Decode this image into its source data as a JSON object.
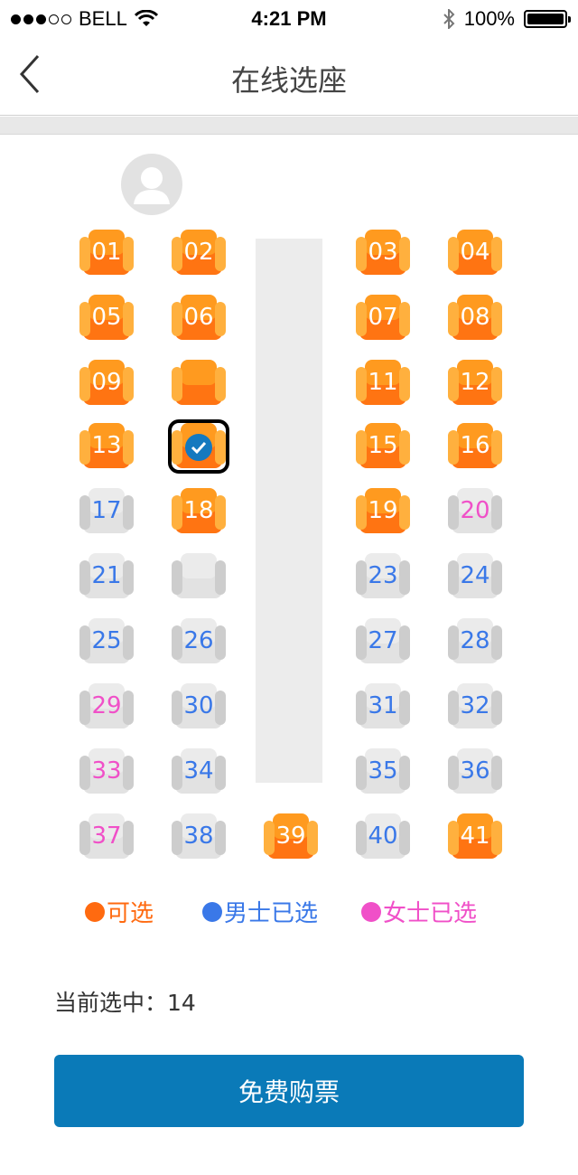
{
  "status_bar": {
    "carrier": "BELL",
    "time": "4:21 PM",
    "battery": "100%"
  },
  "nav": {
    "title": "在线选座"
  },
  "seats": [
    {
      "label": "01",
      "state": "available"
    },
    {
      "label": "02",
      "state": "available"
    },
    {
      "label": "03",
      "state": "available"
    },
    {
      "label": "04",
      "state": "available"
    },
    {
      "label": "05",
      "state": "available"
    },
    {
      "label": "06",
      "state": "available"
    },
    {
      "label": "07",
      "state": "available"
    },
    {
      "label": "08",
      "state": "available"
    },
    {
      "label": "09",
      "state": "available"
    },
    {
      "label": "",
      "state": "available"
    },
    {
      "label": "11",
      "state": "available"
    },
    {
      "label": "12",
      "state": "available"
    },
    {
      "label": "13",
      "state": "available"
    },
    {
      "label": "",
      "state": "selected"
    },
    {
      "label": "15",
      "state": "available"
    },
    {
      "label": "16",
      "state": "available"
    },
    {
      "label": "17",
      "state": "male"
    },
    {
      "label": "18",
      "state": "available"
    },
    {
      "label": "19",
      "state": "available"
    },
    {
      "label": "20",
      "state": "female"
    },
    {
      "label": "21",
      "state": "male"
    },
    {
      "label": "",
      "state": "empty"
    },
    {
      "label": "23",
      "state": "male"
    },
    {
      "label": "24",
      "state": "male"
    },
    {
      "label": "25",
      "state": "male"
    },
    {
      "label": "26",
      "state": "male"
    },
    {
      "label": "27",
      "state": "male"
    },
    {
      "label": "28",
      "state": "male"
    },
    {
      "label": "29",
      "state": "female"
    },
    {
      "label": "30",
      "state": "male"
    },
    {
      "label": "31",
      "state": "male"
    },
    {
      "label": "32",
      "state": "male"
    },
    {
      "label": "33",
      "state": "female"
    },
    {
      "label": "34",
      "state": "male"
    },
    {
      "label": "35",
      "state": "male"
    },
    {
      "label": "36",
      "state": "male"
    },
    {
      "label": "37",
      "state": "female"
    },
    {
      "label": "38",
      "state": "male"
    },
    {
      "label": "39",
      "state": "available"
    },
    {
      "label": "40",
      "state": "male"
    },
    {
      "label": "41",
      "state": "available"
    }
  ],
  "legend": {
    "available": {
      "label": "可选",
      "color": "#ff6a10"
    },
    "male": {
      "label": "男士已选",
      "color": "#3a78e8"
    },
    "female": {
      "label": "女士已选",
      "color": "#f050c8"
    }
  },
  "selection": {
    "label": "当前选中：",
    "value": "14"
  },
  "buy_button": {
    "label": "免费购票"
  },
  "colors": {
    "primary": "#0a7ab8",
    "accent": "#ff7412"
  }
}
